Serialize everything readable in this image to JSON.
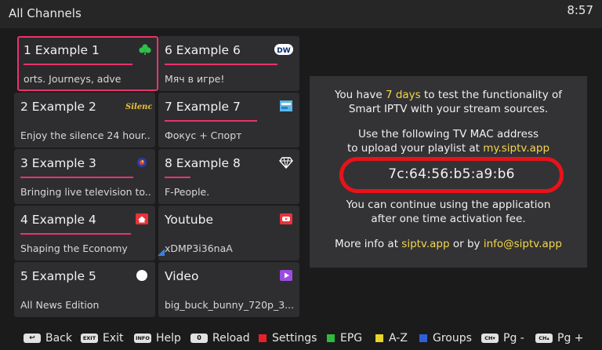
{
  "header": {
    "title": "All Channels",
    "clock": "8:57"
  },
  "channels": [
    {
      "name": "1  Example 1",
      "subtitle": "orts.        Journeys, adve",
      "progress": 0.85,
      "logo": "clover-logo-icon",
      "selected": true
    },
    {
      "name": "2  Example 2",
      "subtitle": "Enjoy the silence 24 hour...",
      "progress": 0.0,
      "logo": "silence-logo-icon",
      "logo_text": "Silence"
    },
    {
      "name": "3  Example 3",
      "subtitle": "Bringing live television to...",
      "progress": 0.88,
      "logo": "globe-logo-icon"
    },
    {
      "name": "4  Example 4",
      "subtitle": "Shaping the Economy",
      "progress": 0.86,
      "logo": "house-logo-icon"
    },
    {
      "name": "5  Example 5",
      "subtitle": "All News Edition",
      "progress": 0.0,
      "logo": "circle-logo-icon"
    },
    {
      "name": "6  Example 6",
      "subtitle": "Мяч в игре!",
      "progress": 0.88,
      "logo": "dw-logo-icon",
      "logo_text": "DW"
    },
    {
      "name": "7  Example 7",
      "subtitle": "Фокус + Спорт",
      "progress": 0.72,
      "logo": "tv-logo-icon"
    },
    {
      "name": "8  Example 8",
      "subtitle": "F-People.",
      "progress": 0.2,
      "logo": "diamond-logo-icon"
    },
    {
      "name": "Youtube",
      "subtitle": "xDMP3i36naA",
      "progress": 0.0,
      "logo": "youtube-logo-icon"
    },
    {
      "name": "Video",
      "subtitle": "big_buck_bunny_720p_3...",
      "progress": 0.0,
      "logo": "video-play-icon"
    }
  ],
  "info": {
    "trial_pre": "You have ",
    "trial_days": "7 days",
    "trial_post": " to test the functionality of",
    "trial_line2": "Smart IPTV with your stream sources.",
    "mac_intro": "Use the following TV MAC address",
    "upload_pre": "to upload your playlist at ",
    "upload_site": "my.siptv.app",
    "mac_address": "7c:64:56:b5:a9:b6",
    "continue_1": "You can continue using the application",
    "continue_2": "after one time activation fee.",
    "more_pre": "More info at ",
    "more_site": "siptv.app",
    "more_mid": " or by ",
    "more_email": "info@siptv.app"
  },
  "colors": {
    "accent": "#e8336b",
    "highlight": "#f5d74a",
    "mac_ring": "#e8121b"
  },
  "footer": [
    {
      "key": "back-key-icon",
      "key_text": "↩",
      "label": "Back"
    },
    {
      "key": "exit-key-icon",
      "key_text": "EXIT",
      "label": "Exit"
    },
    {
      "key": "info-key-icon",
      "key_text": "INFO",
      "label": "Help"
    },
    {
      "key": "zero-key-icon",
      "key_text": "0",
      "label": "Reload"
    },
    {
      "key": "red-key-icon",
      "color": "#e8202a",
      "label": "Settings"
    },
    {
      "key": "green-key-icon",
      "color": "#2dbb3c",
      "label": "EPG"
    },
    {
      "key": "yellow-key-icon",
      "color": "#e8d42a",
      "label": "A-Z"
    },
    {
      "key": "blue-key-icon",
      "color": "#2f5fd8",
      "label": "Groups"
    },
    {
      "key": "ch-down-key-icon",
      "key_text": "CH▾",
      "label": "Pg -"
    },
    {
      "key": "ch-up-key-icon",
      "key_text": "CH▴",
      "label": "Pg +"
    }
  ]
}
